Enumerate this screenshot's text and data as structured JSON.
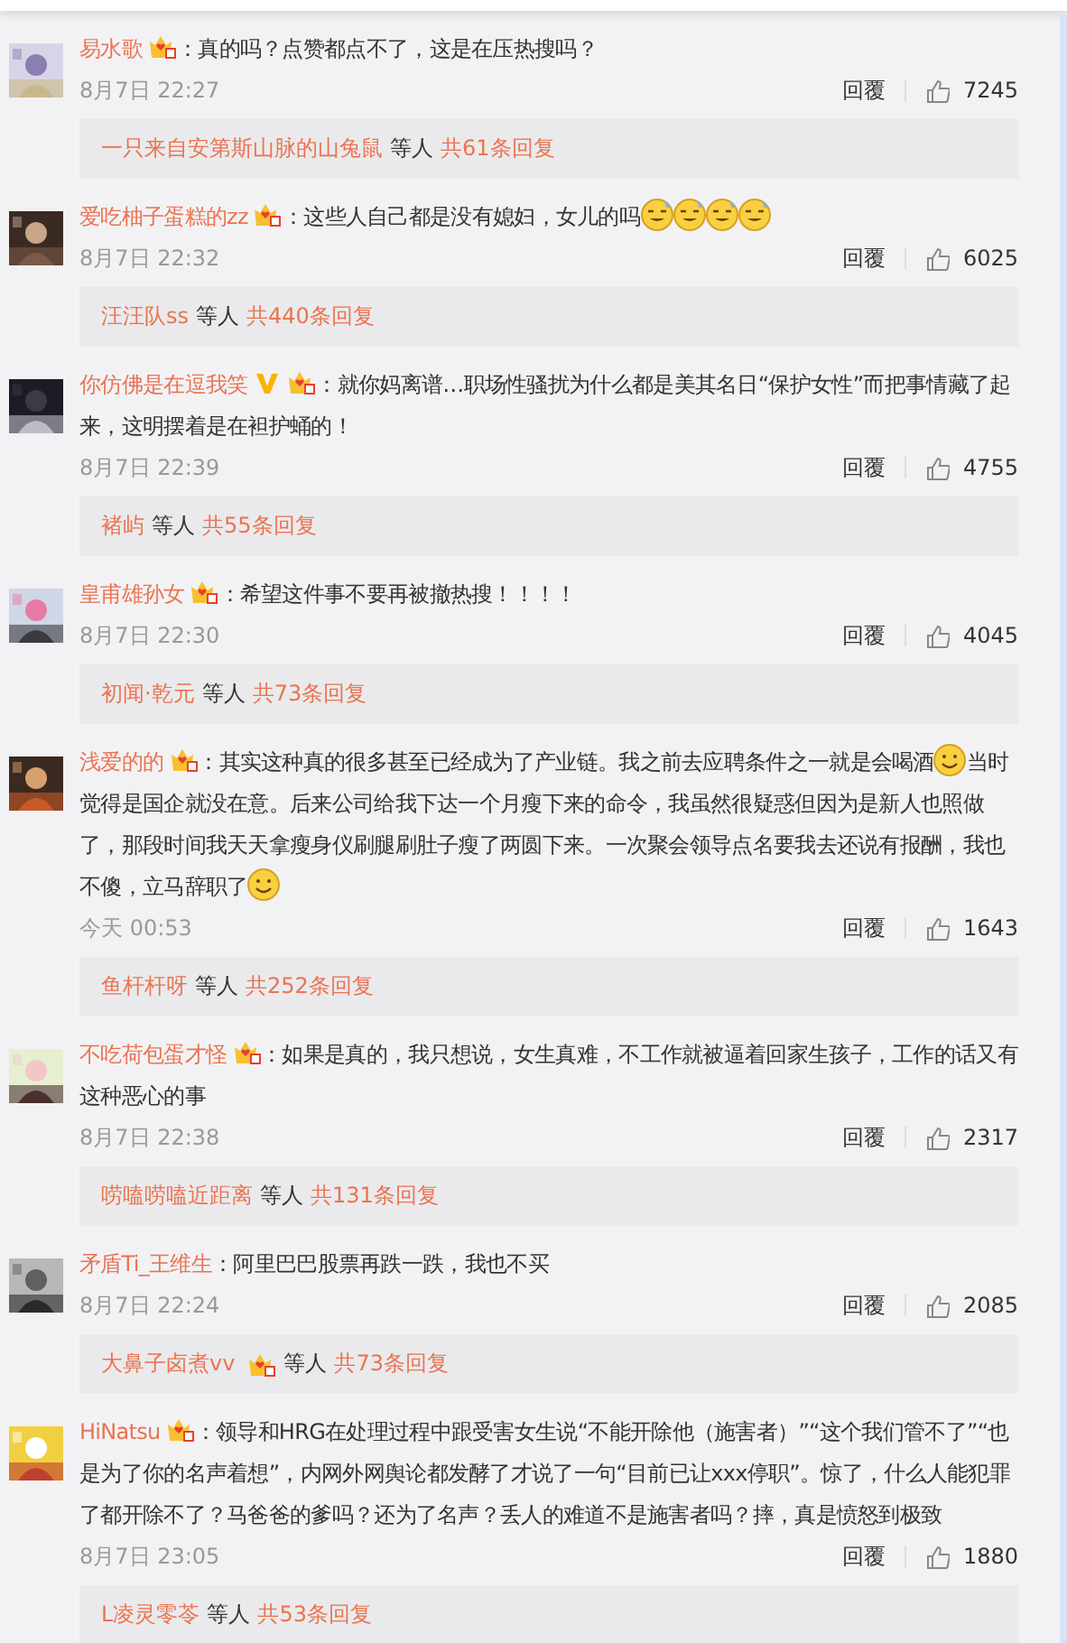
{
  "comments": [
    {
      "user": "易水歌",
      "badges": [
        {
          "kind": "member"
        }
      ],
      "segments": [
        {
          "kind": "text",
          "text": "：真的吗？点赞都点不了，这是在压热搜吗？"
        }
      ],
      "time": "8月7日 22:27",
      "reply_label": "回覆",
      "likes": "7245",
      "replies": {
        "names": "一只来自安第斯山脉的山兔鼠",
        "suffix": "等人",
        "count": "共61条回复"
      }
    },
    {
      "user": "爱吃柚子蛋糕的zz",
      "badges": [
        {
          "kind": "member"
        }
      ],
      "segments": [
        {
          "kind": "text",
          "text": "：这些人自己都是没有媳妇，女儿的吗"
        },
        {
          "kind": "grin"
        },
        {
          "kind": "grin"
        },
        {
          "kind": "grin"
        },
        {
          "kind": "grin"
        }
      ],
      "time": "8月7日 22:32",
      "reply_label": "回覆",
      "likes": "6025",
      "replies": {
        "names": "汪汪队ss",
        "suffix": "等人",
        "count": "共440条回复"
      }
    },
    {
      "user": "你仿佛是在逗我笑",
      "badges": [
        {
          "kind": "verified"
        },
        {
          "kind": "member"
        }
      ],
      "segments": [
        {
          "kind": "text",
          "text": "：就你妈离谱…职场性骚扰为什么都是美其名日“保护女性”而把事情藏了起来，这明摆着是在袒护蛹的！"
        }
      ],
      "time": "8月7日 22:39",
      "reply_label": "回覆",
      "likes": "4755",
      "replies": {
        "names": "褚屿",
        "suffix": "等人",
        "count": "共55条回复"
      }
    },
    {
      "user": "皇甫雄孙女",
      "badges": [
        {
          "kind": "member"
        }
      ],
      "segments": [
        {
          "kind": "text",
          "text": "：希望这件事不要再被撤热搜！！！！"
        }
      ],
      "time": "8月7日 22:30",
      "reply_label": "回覆",
      "likes": "4045",
      "replies": {
        "names": "初闻·乾元",
        "suffix": "等人",
        "count": "共73条回复"
      }
    },
    {
      "user": "浅爱的的",
      "badges": [
        {
          "kind": "member"
        }
      ],
      "segments": [
        {
          "kind": "text",
          "text": "：其实这种真的很多甚至已经成为了产业链。我之前去应聘条件之一就是会喝酒"
        },
        {
          "kind": "smile"
        },
        {
          "kind": "text",
          "text": "当时觉得是国企就没在意。后来公司给我下达一个月瘦下来的命令，我虽然很疑惑但因为是新人也照做了，那段时间我天天拿瘦身仪刷腿刷肚子瘦了两圆下来。一次聚会领导点名要我去还说有报酬，我也不傻，立马辞职了"
        },
        {
          "kind": "smile"
        }
      ],
      "time": "今天 00:53",
      "reply_label": "回覆",
      "likes": "1643",
      "replies": {
        "names": "鱼杆杆呀",
        "suffix": "等人",
        "count": "共252条回复"
      }
    },
    {
      "user": "不吃荷包蛋才怪",
      "badges": [
        {
          "kind": "member"
        }
      ],
      "segments": [
        {
          "kind": "text",
          "text": "：如果是真的，我只想说，女生真难，不工作就被逼着回家生孩子，工作的话又有这种恶心的事"
        }
      ],
      "time": "8月7日 22:38",
      "reply_label": "回覆",
      "likes": "2317",
      "replies": {
        "names": "唠嗑唠嗑近距离",
        "suffix": "等人",
        "count": "共131条回复"
      }
    },
    {
      "user": "矛盾Ti_王维生",
      "segments": [
        {
          "kind": "text",
          "text": "：阿里巴巴股票再跌一跌，我也不买"
        }
      ],
      "time": "8月7日 22:24",
      "reply_label": "回覆",
      "likes": "2085",
      "replies": {
        "names": "大鼻子卤煮vv",
        "badges": [
          {
            "kind": "member"
          }
        ],
        "suffix": "等人",
        "count": "共73条回复"
      }
    },
    {
      "user": "HiNatsu",
      "badges": [
        {
          "kind": "member"
        }
      ],
      "segments": [
        {
          "kind": "text",
          "text": "：领导和HRG在处理过程中跟受害女生说“不能开除他（施害者）”“这个我们管不了”“也是为了你的名声着想”，内网外网舆论都发酵了才说了一句“目前已让xxx停职”。惊了，什么人能犯罪了都开除不了？马爸爸的爹吗？还为了名声？丢人的难道不是施害者吗？摔，真是愤怒到极致"
        }
      ],
      "time": "8月7日 23:05",
      "reply_label": "回覆",
      "likes": "1880",
      "replies": {
        "names": "L凌灵零苓",
        "suffix": "等人",
        "count": "共53条回复"
      }
    }
  ]
}
